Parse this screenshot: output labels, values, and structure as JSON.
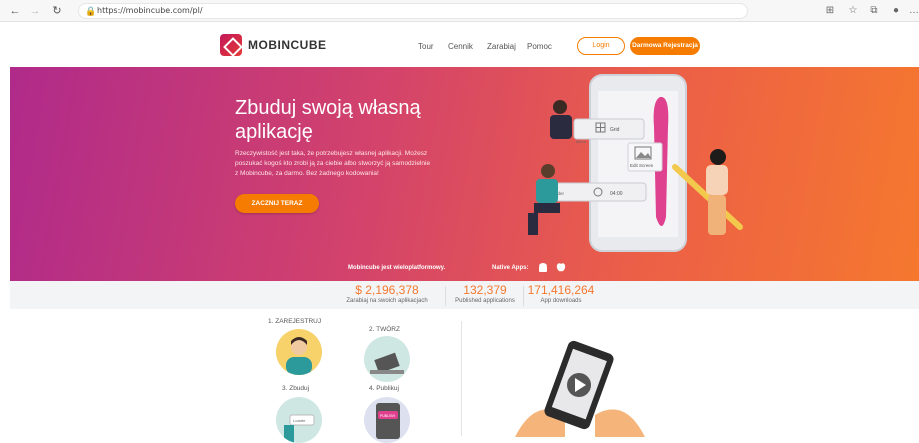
{
  "browser": {
    "url": "https://mobincube.com/pl/",
    "back_icon": "arrow-left-icon",
    "forward_icon": "arrow-right-icon",
    "reload_icon": "reload-icon",
    "lock_icon": "lock-icon"
  },
  "header": {
    "logo_text": "MOBINCUBE",
    "menu": [
      "Tour",
      "Cennik",
      "Zarabiaj",
      "Pomoc"
    ],
    "login_label": "Login",
    "register_label": "Darmowa Rejestracja"
  },
  "hero": {
    "title": "Zbuduj swoją własną aplikację",
    "description": "Rzeczywistość jest taka, że potrzebujesz własnej aplikacji. Możesz poszukać kogoś kto zrobi ją za ciebie albo stworzyć ją samodzielnie z Mobincube, za darmo. Bez żadnego kodowania!",
    "cta_label": "ZACZNIJ TERAZ",
    "platform_text": "Mobincube jest wieloplatformowy.",
    "native_label": "Native Apps:",
    "art": {
      "grid_label": "Grid",
      "menu_label": "Menu",
      "edit_screen_label": "Edit Screen",
      "loader_label": "Loader",
      "loader_time": "04:00"
    }
  },
  "stats": [
    {
      "value": "$ 2,196,378",
      "label": "Zarabiaj na swoich aplikacjach"
    },
    {
      "value": "132,379",
      "label": "Published applications"
    },
    {
      "value": "171,416,264",
      "label": "App downloads"
    }
  ],
  "steps": [
    {
      "label": "1. ZAREJESTRUJ"
    },
    {
      "label": "2. TWÓRZ"
    },
    {
      "label": "3. Zbuduj"
    },
    {
      "label": "4. Publikuj"
    }
  ],
  "steps_art": {
    "step3_badge": "Loader",
    "step4_badge": "PUBLISH"
  },
  "colors": {
    "accent": "#f57c00",
    "hero_start": "#b02a8a",
    "hero_end": "#f5782e"
  }
}
